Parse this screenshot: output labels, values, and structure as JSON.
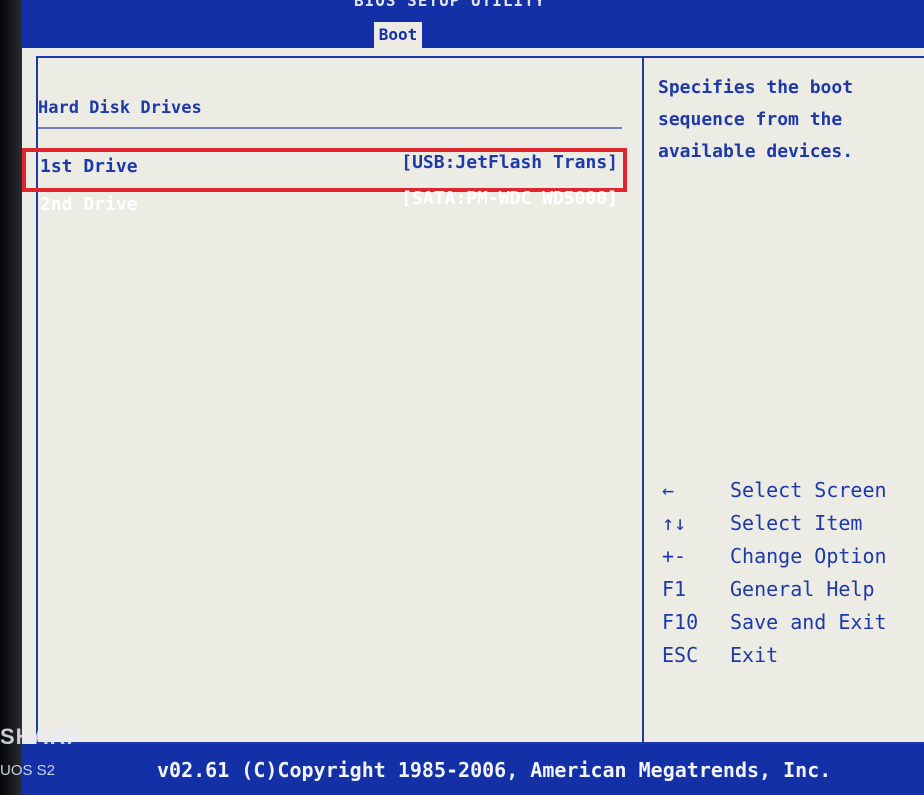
{
  "bios": {
    "header_title": "BIOS SETUP UTILITY",
    "active_tab": "Boot"
  },
  "section": {
    "title": "Hard Disk Drives"
  },
  "drives": [
    {
      "label": "1st Drive",
      "value": "[USB:JetFlash Trans]"
    },
    {
      "label": "2nd Drive",
      "value": "[SATA:PM-WDC WD5000]"
    }
  ],
  "help": {
    "text": "Specifies the boot sequence from the available devices."
  },
  "keys": [
    {
      "key": "←",
      "desc": "Select Screen"
    },
    {
      "key": "↑↓",
      "desc": "Select Item"
    },
    {
      "key": "+-",
      "desc": "Change Option"
    },
    {
      "key": "F1",
      "desc": "General Help"
    },
    {
      "key": "F10",
      "desc": "Save and Exit"
    },
    {
      "key": "ESC",
      "desc": "Exit"
    }
  ],
  "footer": {
    "text": "v02.61 (C)Copyright 1985-2006, American Megatrends, Inc."
  },
  "monitor": {
    "brand": "SHARP",
    "model": "UOS S2"
  },
  "colors": {
    "bios_blue": "#1330a6",
    "panel_bg": "#ecebe4",
    "highlight_red": "#e0262c"
  }
}
